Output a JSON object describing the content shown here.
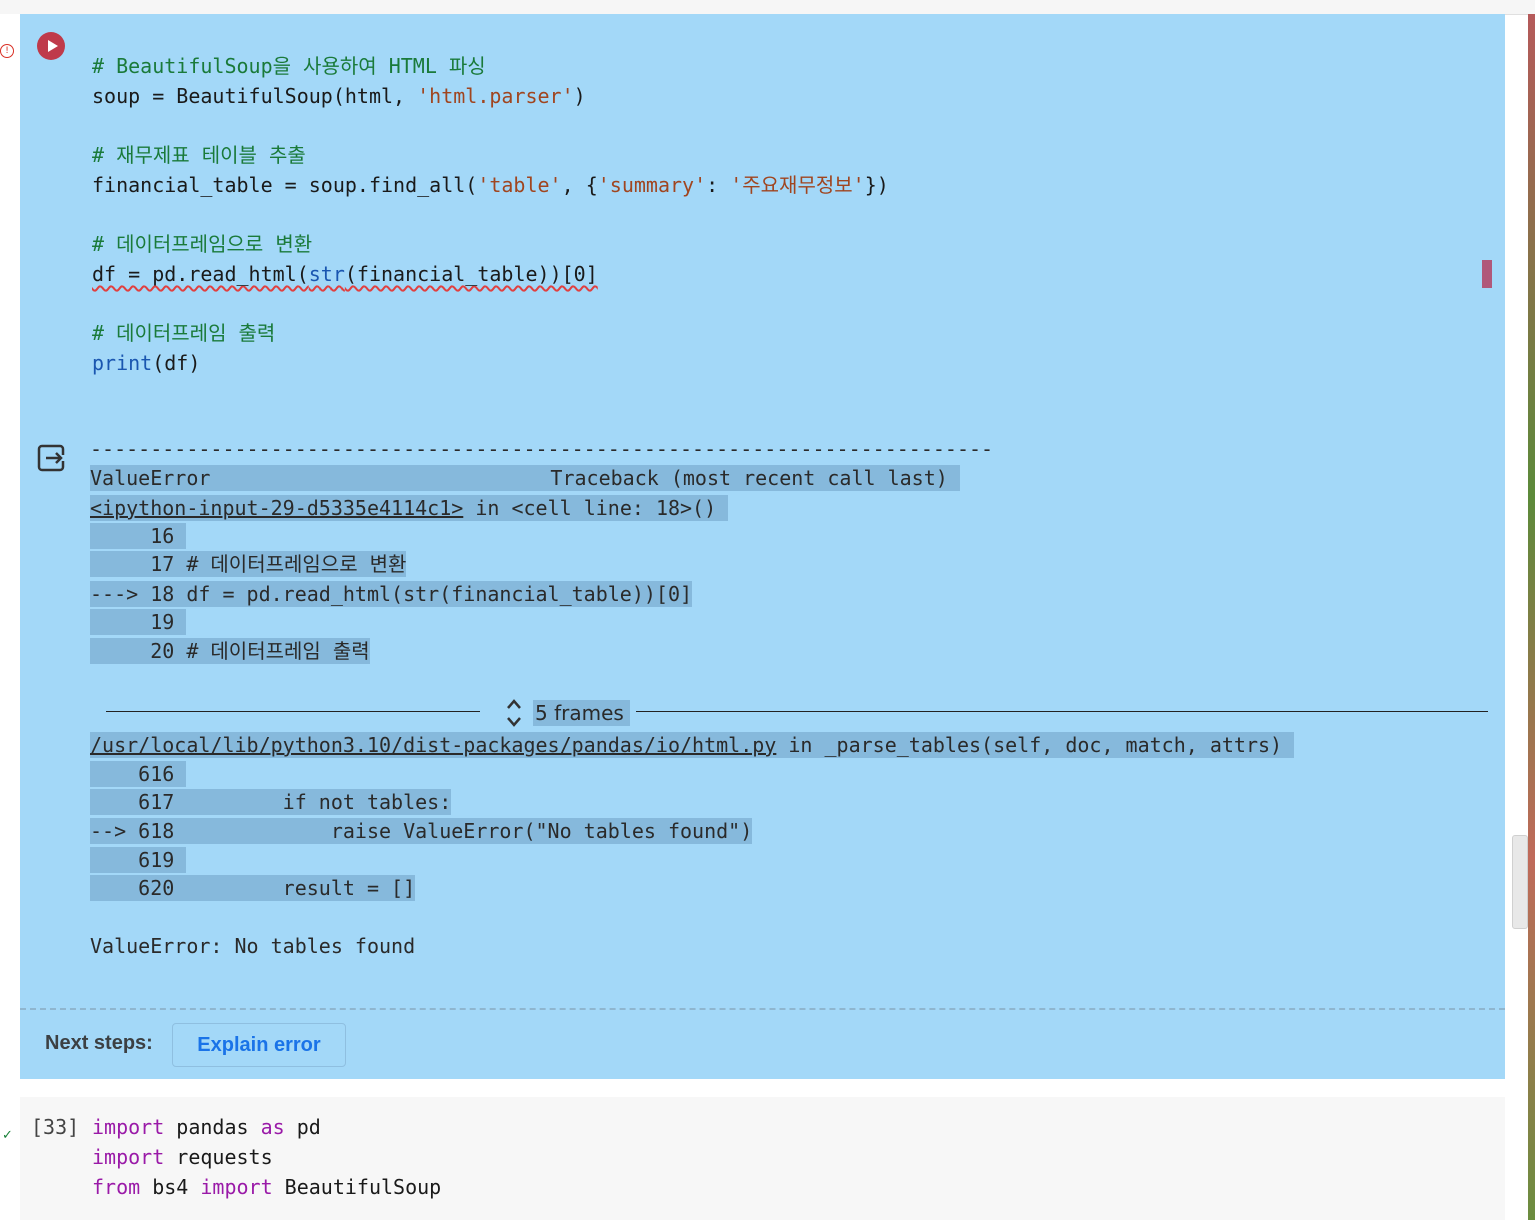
{
  "code_cell": {
    "lines": [
      {
        "comment": "# BeautifulSoup을 사용하여 HTML 파싱"
      },
      {
        "var": "soup = BeautifulSoup(html, ",
        "str": "'html.parser'",
        "close": ")"
      },
      {
        "comment": "# 재무제표 테이블 추출"
      },
      {
        "pre": "financial_table = soup.find_all(",
        "str1": "'table'",
        "mid": ", {",
        "str2": "'summary'",
        "colon": ": ",
        "str3": "'주요재무정보'",
        "close": "})"
      },
      {
        "comment": "# 데이터프레임으로 변환"
      },
      {
        "pre": "df = pd.read_html(",
        "fn": "str",
        "post": "(financial_table))[0]"
      },
      {
        "comment": "# 데이터프레임 출력"
      },
      {
        "fn": "print",
        "post": "(df)"
      }
    ]
  },
  "output": {
    "separator": "---------------------------------------------------------------------------",
    "error_type": "ValueError",
    "traceback_title": "Traceback (most recent call last)",
    "input_link": "<ipython-input-29-d5335e4114c1>",
    "input_loc": " in <cell line: 18>()",
    "frame1": [
      "     16 ",
      "     17 # 데이터프레임으로 변환",
      "---> 18 df = pd.read_html(str(financial_table))[0]",
      "     19 ",
      "     20 # 데이터프레임 출력"
    ],
    "frames_label": "5 frames",
    "file_link": "/usr/local/lib/python3.10/dist-packages/pandas/io/html.py",
    "file_loc": " in _parse_tables(self, doc, match, attrs)",
    "frame2": [
      "    616 ",
      "    617         if not tables:",
      "--> 618             raise ValueError(\"No tables found\")",
      "    619 ",
      "    620         result = []"
    ],
    "final_error": "ValueError: No tables found"
  },
  "next_steps": {
    "label": "Next steps:",
    "explain_button": "Explain error"
  },
  "next_cell": {
    "exec_count": "[33]",
    "line1": {
      "kw1": "import",
      "mod": " pandas ",
      "kw2": "as",
      "alias": " pd"
    },
    "line2": {
      "kw": "import",
      "mod": " requests"
    },
    "line3": {
      "kw1": "from",
      "mod": " bs4 ",
      "kw2": "import",
      "name": " BeautifulSoup"
    }
  },
  "icons": {
    "run": "play-circle-icon",
    "output": "output-redirect-icon",
    "frames": "expand-collapse-icon"
  },
  "colors": {
    "cell_selected_bg": "#a3d8f8",
    "traceback_highlight": "#86b9dc",
    "run_button": "#bf3a4a",
    "link_blue": "#1a73e8"
  }
}
